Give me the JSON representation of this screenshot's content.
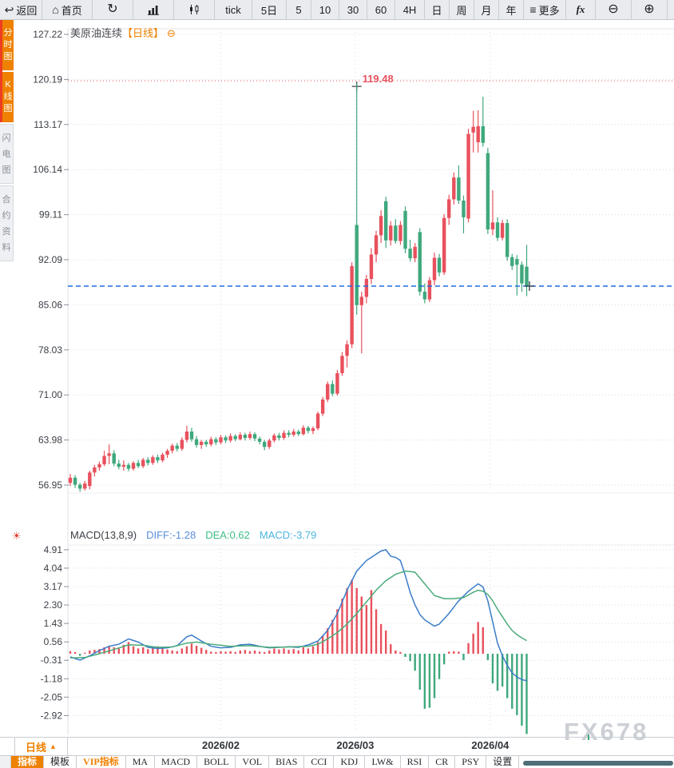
{
  "toolbar": {
    "items": [
      {
        "name": "back",
        "label": "返回",
        "glyph": "↩"
      },
      {
        "name": "home",
        "label": "首页",
        "glyph": "⌂"
      },
      {
        "name": "refresh",
        "label": "",
        "glyph": "↻"
      },
      {
        "name": "bar-chart-mode",
        "label": "",
        "glyph": "",
        "shape": "bars"
      },
      {
        "name": "candlestick-mode",
        "label": "",
        "glyph": "",
        "shape": "candles"
      },
      {
        "name": "tick",
        "label": "tick",
        "glyph": ""
      },
      {
        "name": "5-day",
        "label": "5日",
        "glyph": ""
      },
      {
        "name": "5-min",
        "label": "5",
        "glyph": ""
      },
      {
        "name": "10-min",
        "label": "10",
        "glyph": ""
      },
      {
        "name": "30-min",
        "label": "30",
        "glyph": ""
      },
      {
        "name": "60-min",
        "label": "60",
        "glyph": ""
      },
      {
        "name": "4-hour",
        "label": "4H",
        "glyph": ""
      },
      {
        "name": "day",
        "label": "日",
        "glyph": ""
      },
      {
        "name": "week",
        "label": "周",
        "glyph": ""
      },
      {
        "name": "month",
        "label": "月",
        "glyph": ""
      },
      {
        "name": "year",
        "label": "年",
        "glyph": ""
      },
      {
        "name": "more",
        "label": "更多",
        "glyph": "≡"
      },
      {
        "name": "formula",
        "label": "fx",
        "glyph": ""
      },
      {
        "name": "zoom-out",
        "label": "",
        "glyph": "⊖"
      },
      {
        "name": "zoom-in",
        "label": "",
        "glyph": "⊕"
      }
    ]
  },
  "sidebar": {
    "tabs": [
      {
        "name": "minute-chart",
        "label": "分时图",
        "active": true
      },
      {
        "name": "kline-chart",
        "label": "K线图",
        "active": true
      },
      {
        "name": "lightning-chart",
        "label": "闪电图",
        "active": false
      },
      {
        "name": "contract-info",
        "label": "合约资料",
        "active": false
      }
    ]
  },
  "chart_header": {
    "symbol": "美原油连续",
    "period_tag": "【日线】"
  },
  "icons": {
    "collapse": "⊖",
    "sun": "☀",
    "dropdown_up": "▲"
  },
  "macd_header": {
    "name": "MACD(13,8,9)",
    "diff_label": "DIFF:-1.28",
    "dea_label": "DEA:0.62",
    "macd_label": "MACD:-3.79"
  },
  "xaxis": {
    "period_selector": "日线"
  },
  "bottom_tabs": [
    {
      "name": "indicator",
      "label": "指标",
      "active": true,
      "vip": false
    },
    {
      "name": "template",
      "label": "模板",
      "active": false,
      "vip": false
    },
    {
      "name": "vip-indicator",
      "label": "VIP指标",
      "active": false,
      "vip": true
    },
    {
      "name": "ma",
      "label": "MA",
      "active": false,
      "vip": false
    },
    {
      "name": "macd",
      "label": "MACD",
      "active": false,
      "vip": false
    },
    {
      "name": "boll",
      "label": "BOLL",
      "active": false,
      "vip": false
    },
    {
      "name": "vol",
      "label": "VOL",
      "active": false,
      "vip": false
    },
    {
      "name": "bias",
      "label": "BIAS",
      "active": false,
      "vip": false
    },
    {
      "name": "cci",
      "label": "CCI",
      "active": false,
      "vip": false
    },
    {
      "name": "kdj",
      "label": "KDJ",
      "active": false,
      "vip": false
    },
    {
      "name": "lwr",
      "label": "LW&",
      "active": false,
      "vip": false
    },
    {
      "name": "rsi",
      "label": "RSI",
      "active": false,
      "vip": false
    },
    {
      "name": "cr",
      "label": "CR",
      "active": false,
      "vip": false
    },
    {
      "name": "psy",
      "label": "PSY",
      "active": false,
      "vip": false
    },
    {
      "name": "settings",
      "label": "设置",
      "active": false,
      "vip": false
    }
  ],
  "watermark": "FX678",
  "colors": {
    "accent_orange": "#ef8100",
    "up_red": "#e8515d",
    "down_green": "#3fa87c",
    "diff_blue": "#3a7cc9",
    "dea_green": "#4bab7a",
    "diff_label": "#5b8dd9",
    "dea_label": "#3dbd87",
    "macd_label": "#4ab5e2",
    "price_line_blue": "#1e6ee0",
    "grid": "#dadce2",
    "tick": "#8d939c",
    "axis_text": "#3a3e45"
  },
  "chart_data": {
    "type": "candlestick+macd",
    "title": "美原油连续【日线】",
    "price_axis_labels": [
      "127.22",
      "120.19",
      "113.17",
      "106.14",
      "99.11",
      "92.09",
      "85.06",
      "78.03",
      "71.00",
      "63.98",
      "56.95"
    ],
    "price_range": [
      56.95,
      127.22
    ],
    "high_annotation": {
      "label": "119.48",
      "price": 119.48,
      "candle_index": 59
    },
    "current_price": 87.97,
    "x_labels": [
      {
        "label": "2026/02",
        "pos": 31
      },
      {
        "label": "2026/03",
        "pos": 58.7
      },
      {
        "label": "2026/04",
        "pos": 86.5
      }
    ],
    "candles": [
      [
        57.3,
        58.7,
        56.8,
        58.1
      ],
      [
        58.1,
        58.5,
        56.5,
        57.0
      ],
      [
        57.0,
        57.3,
        55.9,
        56.4
      ],
      [
        56.4,
        57.6,
        56.1,
        57.2
      ],
      [
        56.8,
        59.2,
        56.3,
        58.9
      ],
      [
        58.9,
        60.1,
        58.3,
        59.7
      ],
      [
        59.7,
        60.6,
        59.2,
        60.2
      ],
      [
        60.2,
        62.3,
        59.9,
        61.5
      ],
      [
        61.5,
        63.3,
        60.2,
        61.9
      ],
      [
        61.9,
        62.4,
        59.9,
        60.3
      ],
      [
        60.3,
        60.9,
        59.4,
        59.8
      ],
      [
        59.8,
        60.8,
        59.2,
        60.1
      ],
      [
        60.1,
        60.4,
        59.1,
        59.5
      ],
      [
        59.5,
        60.7,
        59.2,
        60.4
      ],
      [
        60.4,
        60.9,
        59.6,
        59.9
      ],
      [
        59.9,
        61.2,
        59.6,
        60.9
      ],
      [
        60.9,
        61.3,
        60.0,
        60.4
      ],
      [
        60.4,
        61.6,
        60.1,
        61.3
      ],
      [
        61.3,
        61.7,
        60.4,
        60.8
      ],
      [
        60.8,
        62.0,
        60.5,
        61.7
      ],
      [
        61.7,
        62.6,
        61.2,
        62.3
      ],
      [
        62.3,
        63.4,
        61.9,
        63.1
      ],
      [
        63.1,
        63.5,
        62.2,
        62.6
      ],
      [
        62.6,
        64.4,
        62.3,
        64.0
      ],
      [
        64.0,
        66.2,
        63.6,
        65.3
      ],
      [
        65.3,
        65.9,
        63.7,
        64.1
      ],
      [
        64.1,
        64.6,
        62.8,
        63.2
      ],
      [
        63.2,
        64.0,
        62.6,
        63.7
      ],
      [
        63.7,
        64.0,
        62.9,
        63.3
      ],
      [
        63.3,
        64.5,
        63.0,
        64.1
      ],
      [
        64.1,
        64.4,
        63.2,
        63.6
      ],
      [
        63.6,
        64.8,
        63.3,
        64.4
      ],
      [
        64.4,
        64.7,
        63.5,
        63.9
      ],
      [
        63.9,
        65.0,
        63.6,
        64.6
      ],
      [
        64.6,
        64.9,
        63.8,
        64.1
      ],
      [
        64.1,
        65.2,
        63.9,
        64.8
      ],
      [
        64.8,
        65.1,
        63.9,
        64.3
      ],
      [
        64.3,
        65.3,
        64.0,
        64.9
      ],
      [
        64.9,
        65.2,
        63.8,
        64.2
      ],
      [
        64.2,
        64.5,
        63.3,
        63.7
      ],
      [
        63.7,
        64.0,
        62.4,
        62.9
      ],
      [
        62.9,
        64.2,
        62.6,
        63.9
      ],
      [
        63.9,
        65.0,
        63.6,
        64.7
      ],
      [
        64.7,
        65.1,
        63.9,
        64.3
      ],
      [
        64.3,
        65.5,
        64.0,
        65.1
      ],
      [
        65.1,
        65.5,
        64.4,
        64.8
      ],
      [
        64.8,
        65.7,
        64.5,
        65.3
      ],
      [
        65.3,
        65.6,
        64.6,
        64.9
      ],
      [
        64.9,
        66.3,
        64.7,
        65.9
      ],
      [
        65.9,
        66.2,
        65.0,
        65.4
      ],
      [
        65.4,
        66.1,
        64.9,
        65.8
      ],
      [
        65.8,
        68.4,
        65.5,
        68.1
      ],
      [
        68.1,
        70.7,
        67.7,
        70.3
      ],
      [
        70.3,
        73.1,
        69.9,
        72.7
      ],
      [
        72.7,
        73.3,
        70.8,
        71.2
      ],
      [
        71.2,
        74.9,
        70.9,
        74.4
      ],
      [
        74.4,
        77.7,
        74.0,
        77.1
      ],
      [
        77.1,
        79.5,
        75.3,
        78.9
      ],
      [
        78.9,
        91.7,
        78.3,
        91.1
      ],
      [
        97.5,
        119.48,
        83.5,
        85.0
      ],
      [
        85.0,
        87.1,
        77.5,
        86.3
      ],
      [
        86.3,
        89.7,
        85.3,
        89.1
      ],
      [
        89.1,
        93.9,
        88.3,
        92.9
      ],
      [
        92.9,
        96.6,
        91.7,
        95.9
      ],
      [
        95.9,
        99.8,
        94.7,
        98.9
      ],
      [
        101.2,
        101.9,
        93.9,
        95.1
      ],
      [
        95.1,
        98.1,
        94.3,
        97.4
      ],
      [
        97.4,
        98.4,
        94.6,
        95.0
      ],
      [
        95.0,
        98.1,
        94.4,
        97.5
      ],
      [
        99.7,
        100.4,
        93.1,
        93.8
      ],
      [
        93.8,
        95.2,
        91.8,
        92.3
      ],
      [
        92.3,
        94.7,
        91.7,
        94.1
      ],
      [
        96.4,
        97.0,
        86.5,
        87.1
      ],
      [
        87.1,
        88.4,
        85.3,
        85.9
      ],
      [
        85.9,
        89.4,
        85.5,
        88.9
      ],
      [
        88.9,
        93.2,
        88.1,
        92.4
      ],
      [
        92.4,
        93.0,
        89.5,
        90.1
      ],
      [
        90.1,
        99.2,
        89.7,
        98.6
      ],
      [
        98.6,
        102.2,
        97.5,
        101.5
      ],
      [
        101.5,
        105.7,
        100.7,
        104.9
      ],
      [
        104.9,
        106.8,
        100.8,
        101.3
      ],
      [
        101.3,
        102.1,
        96.2,
        98.7
      ],
      [
        98.5,
        112.5,
        97.9,
        111.7
      ],
      [
        111.9,
        115.3,
        108.8,
        112.8
      ],
      [
        110.4,
        115.4,
        108.8,
        112.9
      ],
      [
        112.9,
        117.5,
        109.7,
        110.3
      ],
      [
        108.7,
        109.5,
        96.1,
        96.8
      ],
      [
        96.8,
        102.9,
        95.9,
        97.9
      ],
      [
        97.9,
        98.7,
        95.0,
        95.5
      ],
      [
        95.5,
        98.3,
        95.1,
        97.8
      ],
      [
        97.8,
        98.4,
        91.9,
        92.5
      ],
      [
        92.5,
        93.0,
        90.5,
        91.1
      ],
      [
        92.2,
        92.8,
        86.5,
        91.3
      ],
      [
        91.3,
        91.8,
        87.1,
        88.4
      ],
      [
        91.0,
        94.4,
        86.4,
        88.0
      ]
    ],
    "macd": {
      "params": "13,8,9",
      "diff": -1.28,
      "dea": 0.62,
      "macd": -3.79,
      "axis_labels": [
        "4.91",
        "4.04",
        "3.17",
        "2.30",
        "1.43",
        "0.56",
        "-0.31",
        "-1.18",
        "-2.05",
        "-2.92"
      ],
      "hist": [
        0.12,
        0.08,
        -0.1,
        0.05,
        0.15,
        0.18,
        0.22,
        0.3,
        0.38,
        0.3,
        0.25,
        0.42,
        0.55,
        0.35,
        0.25,
        0.3,
        0.22,
        0.28,
        0.35,
        0.28,
        0.2,
        0.15,
        0.12,
        0.25,
        0.35,
        0.48,
        0.38,
        0.28,
        0.18,
        0.1,
        0.08,
        0.12,
        0.1,
        0.12,
        0.08,
        0.15,
        0.18,
        0.12,
        0.15,
        0.1,
        0.08,
        0.15,
        0.25,
        0.2,
        0.25,
        0.18,
        0.22,
        0.15,
        0.3,
        0.25,
        0.35,
        0.55,
        0.85,
        1.2,
        1.6,
        2.1,
        2.6,
        3.1,
        3.5,
        3.1,
        2.7,
        2.3,
        3.0,
        2.1,
        1.4,
        1.1,
        0.45,
        0.15,
        0.08,
        -0.15,
        -0.35,
        -0.8,
        -1.7,
        -2.6,
        -2.55,
        -2.1,
        -1.2,
        -0.5,
        0.1,
        0.12,
        0.1,
        -0.3,
        0.5,
        0.95,
        1.5,
        1.25,
        -0.3,
        -1.4,
        -1.75,
        -1.55,
        -2.1,
        -2.6,
        -2.9,
        -3.4,
        -3.79
      ],
      "diff_line": [
        [
          0,
          -0.15
        ],
        [
          2,
          -0.3
        ],
        [
          4,
          -0.1
        ],
        [
          6,
          0.15
        ],
        [
          8,
          0.35
        ],
        [
          10,
          0.45
        ],
        [
          12,
          0.7
        ],
        [
          14,
          0.55
        ],
        [
          16,
          0.3
        ],
        [
          18,
          0.25
        ],
        [
          20,
          0.28
        ],
        [
          22,
          0.38
        ],
        [
          24,
          0.8
        ],
        [
          25,
          0.88
        ],
        [
          27,
          0.6
        ],
        [
          29,
          0.35
        ],
        [
          31,
          0.28
        ],
        [
          33,
          0.3
        ],
        [
          35,
          0.42
        ],
        [
          37,
          0.45
        ],
        [
          39,
          0.35
        ],
        [
          41,
          0.28
        ],
        [
          43,
          0.3
        ],
        [
          45,
          0.33
        ],
        [
          47,
          0.3
        ],
        [
          49,
          0.42
        ],
        [
          51,
          0.6
        ],
        [
          53,
          1.1
        ],
        [
          55,
          1.9
        ],
        [
          57,
          3.0
        ],
        [
          59,
          3.9
        ],
        [
          61,
          4.4
        ],
        [
          63,
          4.7
        ],
        [
          64,
          4.85
        ],
        [
          65,
          4.91
        ],
        [
          66,
          4.6
        ],
        [
          67,
          4.55
        ],
        [
          68,
          4.4
        ],
        [
          69,
          3.7
        ],
        [
          70,
          2.9
        ],
        [
          71,
          2.3
        ],
        [
          72,
          1.85
        ],
        [
          73,
          1.6
        ],
        [
          74,
          1.45
        ],
        [
          75,
          1.3
        ],
        [
          76,
          1.4
        ],
        [
          78,
          1.9
        ],
        [
          80,
          2.5
        ],
        [
          82,
          2.95
        ],
        [
          84,
          3.3
        ],
        [
          85,
          3.15
        ],
        [
          86,
          2.5
        ],
        [
          87,
          1.5
        ],
        [
          88,
          0.5
        ],
        [
          89,
          -0.1
        ],
        [
          90,
          -0.55
        ],
        [
          91,
          -0.9
        ],
        [
          92,
          -1.1
        ],
        [
          93,
          -1.22
        ],
        [
          94,
          -1.28
        ]
      ],
      "dea_line": [
        [
          0,
          -0.2
        ],
        [
          3,
          -0.18
        ],
        [
          6,
          0.0
        ],
        [
          9,
          0.2
        ],
        [
          12,
          0.42
        ],
        [
          15,
          0.4
        ],
        [
          18,
          0.3
        ],
        [
          21,
          0.32
        ],
        [
          24,
          0.5
        ],
        [
          26,
          0.55
        ],
        [
          29,
          0.45
        ],
        [
          33,
          0.35
        ],
        [
          37,
          0.38
        ],
        [
          41,
          0.3
        ],
        [
          45,
          0.32
        ],
        [
          49,
          0.35
        ],
        [
          51,
          0.45
        ],
        [
          53,
          0.7
        ],
        [
          55,
          1.0
        ],
        [
          57,
          1.4
        ],
        [
          59,
          1.9
        ],
        [
          61,
          2.45
        ],
        [
          63,
          3.0
        ],
        [
          65,
          3.45
        ],
        [
          67,
          3.75
        ],
        [
          69,
          3.9
        ],
        [
          71,
          3.85
        ],
        [
          73,
          3.3
        ],
        [
          75,
          2.75
        ],
        [
          77,
          2.6
        ],
        [
          79,
          2.6
        ],
        [
          81,
          2.65
        ],
        [
          83,
          2.9
        ],
        [
          84,
          3.0
        ],
        [
          85,
          2.95
        ],
        [
          86,
          2.8
        ],
        [
          87,
          2.5
        ],
        [
          88,
          2.1
        ],
        [
          89,
          1.75
        ],
        [
          90,
          1.4
        ],
        [
          91,
          1.1
        ],
        [
          92,
          0.9
        ],
        [
          93,
          0.75
        ],
        [
          94,
          0.62
        ]
      ]
    }
  }
}
